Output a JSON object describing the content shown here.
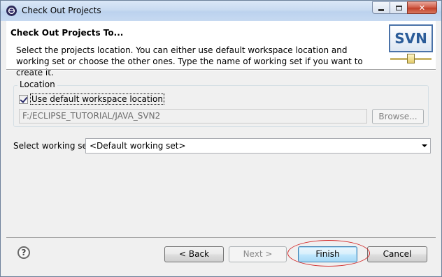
{
  "window": {
    "title": "Check Out Projects"
  },
  "header": {
    "title": "Check Out Projects To...",
    "description": "Select the projects location. You can either use default workspace location and working set or choose the other ones. Type the name of working set if you want to create it.",
    "logo_text": "SVN"
  },
  "location": {
    "group_label": "Location",
    "use_default_label": "Use default workspace location",
    "use_default_checked": true,
    "path_value": "F:/ECLIPSE_TUTORIAL/JAVA_SVN2",
    "browse_label": "Browse..."
  },
  "working_set": {
    "label": "Select working set:",
    "selected": "<Default working set>"
  },
  "footer": {
    "back_label": "< Back",
    "next_label": "Next >",
    "finish_label": "Finish",
    "cancel_label": "Cancel"
  },
  "icons": {
    "app": "eclipse-icon",
    "help": "help-icon",
    "minimize": "minimize-icon",
    "maximize": "maximize-icon",
    "close": "close-icon",
    "dropdown": "chevron-down-icon"
  },
  "colors": {
    "title_bar": "#c9dbf1",
    "close_button": "#c2412a",
    "finish_button": "#bee6fd",
    "highlight_ellipse": "#d22a2a",
    "svn_logo": "#2b5c99"
  }
}
